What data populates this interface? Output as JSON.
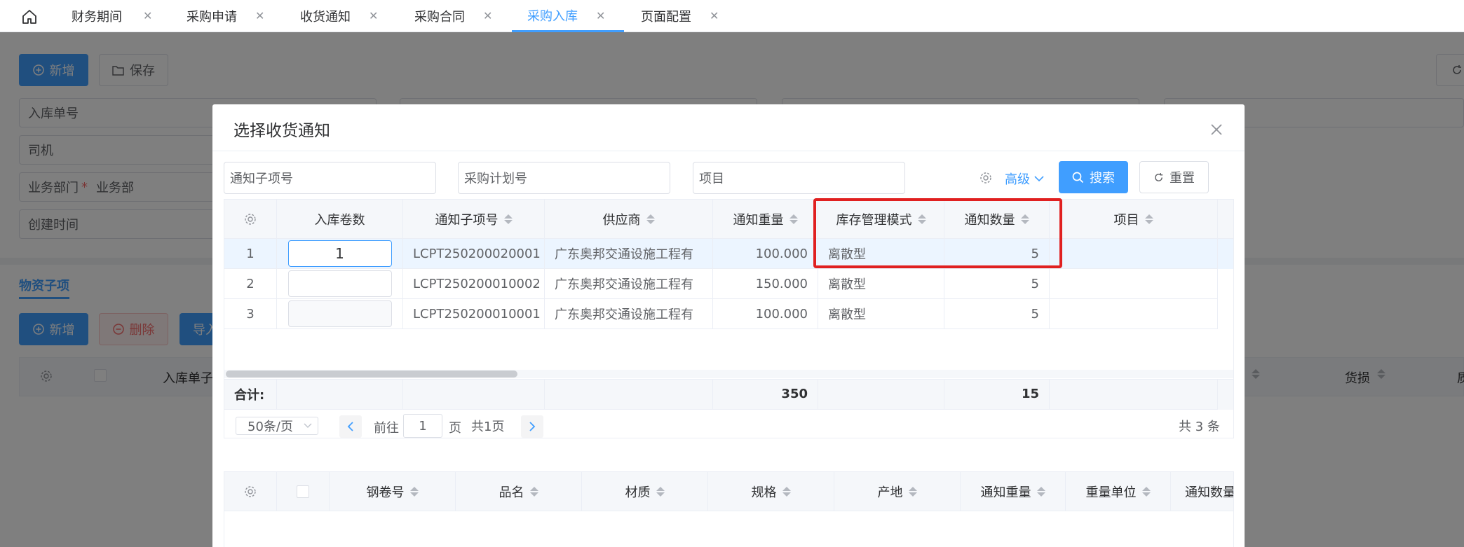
{
  "tabs": [
    {
      "label": "财务期间",
      "active": false
    },
    {
      "label": "采购申请",
      "active": false
    },
    {
      "label": "收货通知",
      "active": false
    },
    {
      "label": "采购合同",
      "active": false
    },
    {
      "label": "采购入库",
      "active": true
    },
    {
      "label": "页面配置",
      "active": false
    }
  ],
  "tab_close_glyph": "✕",
  "background": {
    "toolbar": {
      "add_label": "新增",
      "save_label": "保存"
    },
    "form": {
      "inbound_no_label": "入库单号",
      "driver_label": "司机",
      "department_label": "业务部门",
      "department_required": "*",
      "department_value": "业务部",
      "create_time_label": "创建时间"
    },
    "section_tab": "物资子项",
    "sub_toolbar": {
      "add_label": "新增",
      "delete_label": "删除",
      "import_label": "导入"
    },
    "table_headers": {
      "inbound_sub": "入库单子",
      "damage": "货损",
      "last_partial": "质"
    }
  },
  "dialog": {
    "title": "选择收货通知",
    "close_glyph": "×",
    "search": {
      "notice_sub_placeholder": "通知子项号",
      "plan_no_placeholder": "采购计划号",
      "project_placeholder": "项目",
      "advanced_label": "高级",
      "search_label": "搜索",
      "reset_label": "重置"
    },
    "top_table": {
      "columns": [
        "入库卷数",
        "通知子项号",
        "供应商",
        "通知重量",
        "库存管理模式",
        "通知数量",
        "项目"
      ],
      "rows": [
        {
          "index": "1",
          "rolls": "1",
          "notice_sub": "LCPT250200020001",
          "supplier": "广东奥邦交通设施工程有",
          "weight": "100.000",
          "mode": "离散型",
          "qty": "5",
          "project": ""
        },
        {
          "index": "2",
          "rolls": "",
          "notice_sub": "LCPT250200010002",
          "supplier": "广东奥邦交通设施工程有",
          "weight": "150.000",
          "mode": "离散型",
          "qty": "5",
          "project": ""
        },
        {
          "index": "3",
          "rolls": "",
          "notice_sub": "LCPT250200010001",
          "supplier": "广东奥邦交通设施工程有",
          "weight": "100.000",
          "mode": "离散型",
          "qty": "5",
          "project": ""
        }
      ],
      "total_label": "合计:",
      "total_weight": "350",
      "total_qty": "15"
    },
    "pagination": {
      "page_size": "50条/页",
      "goto_label": "前往",
      "page_value": "1",
      "page_unit": "页",
      "page_count": "共1页",
      "total_text": "共 3 条"
    },
    "bottom_table": {
      "columns": [
        "钢卷号",
        "品名",
        "材质",
        "规格",
        "产地",
        "通知重量",
        "重量单位",
        "通知数量"
      ]
    }
  },
  "colors": {
    "primary": "#409eff",
    "highlight_box": "#e02020",
    "danger": "#f56c6c"
  }
}
